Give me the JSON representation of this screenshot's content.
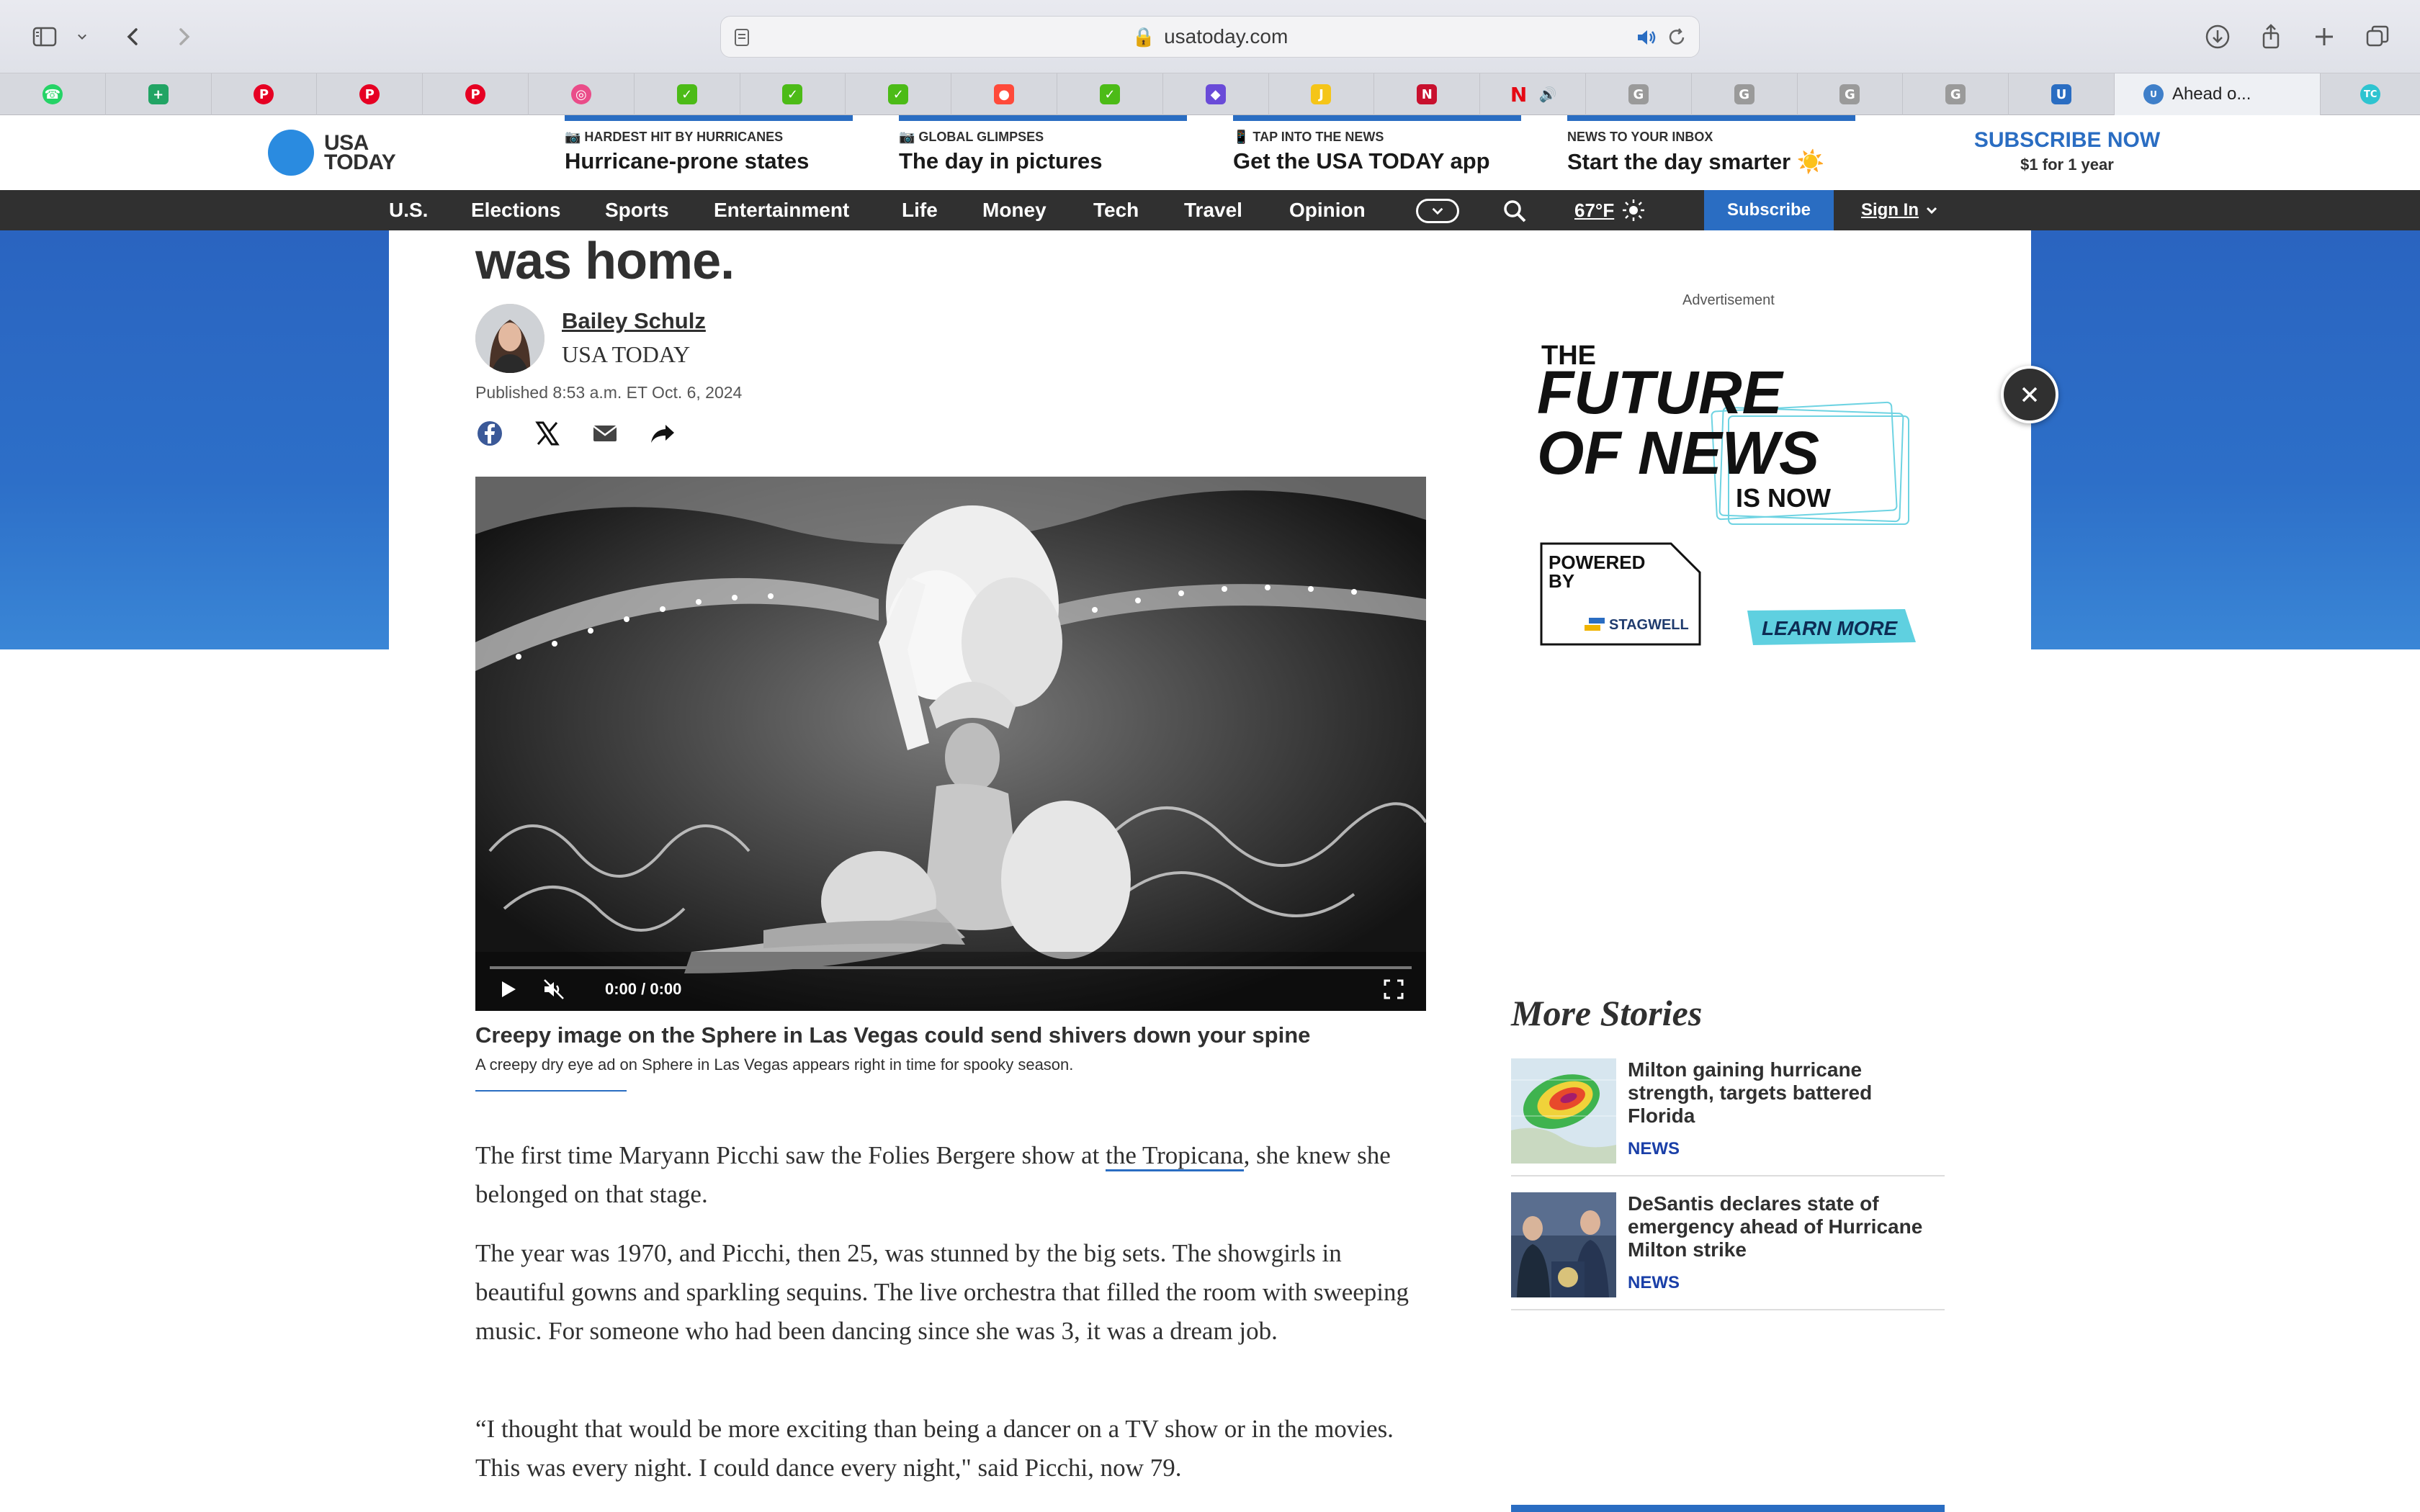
{
  "browser": {
    "url": "usatoday.com",
    "tabs": [
      {
        "icon": "whatsapp-icon",
        "color": "#25d366"
      },
      {
        "icon": "sheets-plus-icon",
        "color": "#21a464"
      },
      {
        "icon": "pinterest-icon",
        "color": "#e60023"
      },
      {
        "icon": "pinterest-icon",
        "color": "#e60023"
      },
      {
        "icon": "pinterest-icon",
        "color": "#e60023"
      },
      {
        "icon": "dribbble-icon",
        "color": "#ea4c89"
      },
      {
        "icon": "green-app-icon",
        "color": "#4cbb17"
      },
      {
        "icon": "green-app-icon",
        "color": "#4cbb17"
      },
      {
        "icon": "green-app-icon",
        "color": "#4cbb17"
      },
      {
        "icon": "red-app-icon",
        "color": "#ff4a3a"
      },
      {
        "icon": "green-app-icon",
        "color": "#4cbb17"
      },
      {
        "icon": "shield-app-icon",
        "color": "#6a4bd8"
      },
      {
        "icon": "yellow-app-icon",
        "color": "#f5c518"
      },
      {
        "icon": "red-n-icon",
        "color": "#c8102e"
      },
      {
        "icon": "netflix-icon",
        "color": "#e50914",
        "audio": true
      },
      {
        "icon": "letter-g-icon",
        "color": "#9a9a9a"
      },
      {
        "icon": "letter-g-icon",
        "color": "#9a9a9a"
      },
      {
        "icon": "letter-g-icon",
        "color": "#9a9a9a"
      },
      {
        "icon": "letter-g-icon",
        "color": "#9a9a9a"
      },
      {
        "icon": "usn-icon",
        "color": "#2a6dc2"
      }
    ],
    "active_tab_title": "Ahead o...",
    "last_tab_icon_color": "#2ec4d0"
  },
  "site": {
    "logo_line1": "USA",
    "logo_line2": "TODAY",
    "promos": [
      {
        "kicker": "📷 HARDEST HIT BY HURRICANES",
        "headline": "Hurricane-prone states"
      },
      {
        "kicker": "📷 GLOBAL GLIMPSES",
        "headline": "The day in pictures"
      },
      {
        "kicker": "📱 TAP INTO THE NEWS",
        "headline": "Get the USA TODAY app"
      },
      {
        "kicker": "NEWS TO YOUR INBOX",
        "headline": "Start the day smarter ☀️"
      }
    ],
    "subscribe_cta": {
      "title": "SUBSCRIBE NOW",
      "subtitle": "$1 for 1 year"
    },
    "nav": [
      "U.S.",
      "Elections",
      "Sports",
      "Entertainment",
      "Life",
      "Money",
      "Tech",
      "Travel",
      "Opinion"
    ],
    "temperature": "67°F",
    "subscribe_button": "Subscribe",
    "sign_in": "Sign In"
  },
  "article": {
    "headline_tail": "was home.",
    "author": "Bailey Schulz",
    "author_org": "USA TODAY",
    "published": "Published 8:53 a.m. ET Oct. 6, 2024",
    "video": {
      "time": "0:00 / 0:00",
      "progress": 0,
      "title": "Creepy image on the Sphere in Las Vegas could send shivers down your spine",
      "description": "A creepy dry eye ad on Sphere in Las Vegas appears right in time for spooky season."
    },
    "paragraphs": [
      {
        "before": "The first time Maryann Picchi saw the Folies Bergere show at ",
        "link": "the Tropicana",
        "after": ", she knew she belonged on that stage."
      },
      {
        "text": "The year was 1970, and Picchi, then 25, was stunned by the big sets. The showgirls in beautiful gowns and sparkling sequins. The live orchestra that filled the room with sweeping music. For someone who had been dancing since she was 3, it was a dream job."
      },
      {
        "text": "“I thought that would be more exciting than being a dancer on a TV show or in the movies. This was every night. I could dance every night,\" said Picchi, now 79."
      }
    ]
  },
  "rail": {
    "ad_label": "Advertisement",
    "ad": {
      "line1": "THE",
      "line2": "FUTURE",
      "line3": "OF NEWS",
      "line4": "IS NOW",
      "powered": "POWERED",
      "by": "BY",
      "sponsor": "STAGWELL",
      "cta": "LEARN MORE"
    },
    "more_stories_title": "More Stories",
    "stories": [
      {
        "title": "Milton gaining hurricane strength, targets battered Florida",
        "tag": "NEWS"
      },
      {
        "title": "DeSantis declares state of emergency ahead of Hurricane Milton strike",
        "tag": "NEWS"
      }
    ]
  }
}
